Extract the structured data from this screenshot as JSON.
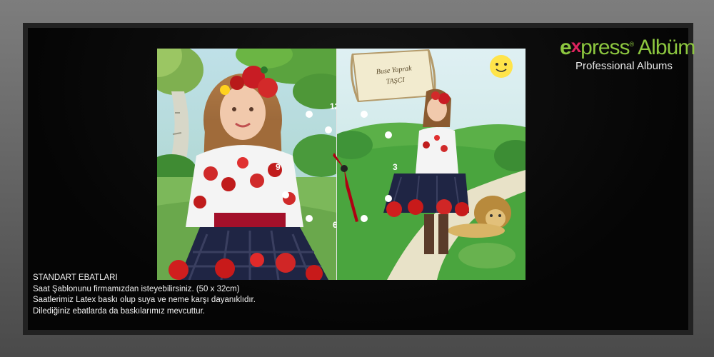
{
  "logo": {
    "brand_e": "e",
    "brand_x": "x",
    "brand_press": "press",
    "reg": "®",
    "brand_album": "Albüm",
    "tagline": "Professional Albums"
  },
  "clock": {
    "banner_line1": "Buse Yaprak",
    "banner_line2": "TAŞCI",
    "numerals": {
      "twelve": "12",
      "three": "3",
      "six": "6",
      "nine": "9"
    }
  },
  "description": {
    "heading": "STANDART EBATLARI",
    "line1": "Saat Şablonunu firmamızdan isteyebilirsiniz. (50 x 32cm)",
    "line2": "Saatlerimiz Latex baskı olup suya ve neme karşı dayanıklıdır.",
    "line3": "Dilediğiniz ebatlarda da baskılarımız mevcuttur."
  }
}
